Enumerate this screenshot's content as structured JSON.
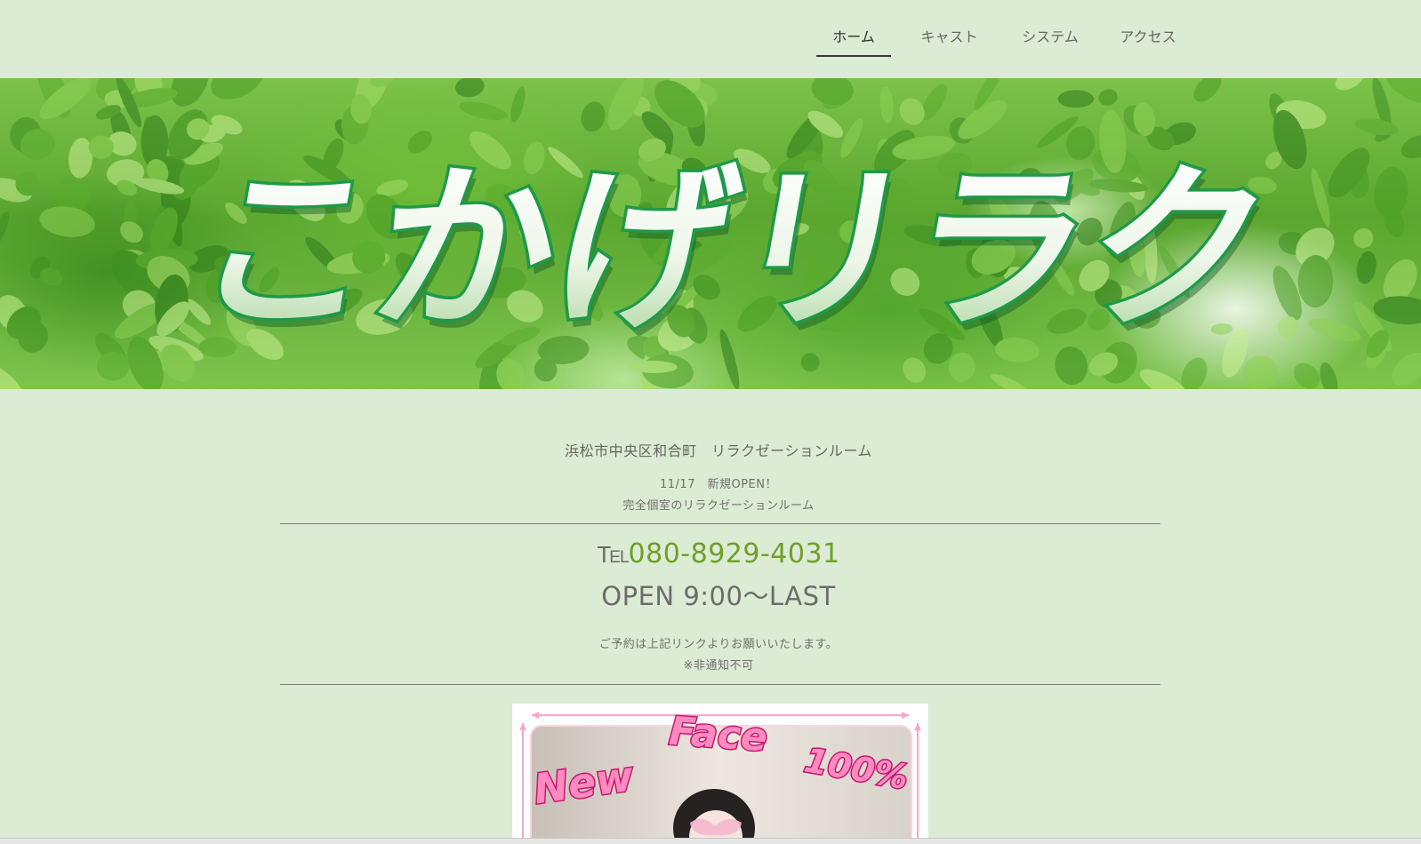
{
  "nav": {
    "items": [
      {
        "label": "ホーム",
        "active": true
      },
      {
        "label": "キャスト",
        "active": false
      },
      {
        "label": "システム",
        "active": false
      },
      {
        "label": "アクセス",
        "active": false
      }
    ]
  },
  "hero": {
    "logo_text": "こかげリラク"
  },
  "intro": {
    "location": "浜松市中央区和合町　リラクゼーションルーム",
    "open_notice": "11/17　新規OPEN！",
    "description": "完全個室のリラクゼーションルーム"
  },
  "contact": {
    "tel_prefix_big": "T",
    "tel_prefix_small": "EL",
    "tel_number": "080-8929-4031",
    "hours": "OPEN 9:00～LAST",
    "reservation_note": "ご予約は上記リンクよりお願いいたします。",
    "caller_id_note": "※非通知不可"
  },
  "promo": {
    "word_new": "New",
    "word_face": "Face",
    "word_percent": "100%"
  },
  "colors": {
    "background": "#dcebd3",
    "tel_accent": "#6ea02a",
    "logo_green": "#1e9a48",
    "promo_pink": "#f25fa8"
  }
}
